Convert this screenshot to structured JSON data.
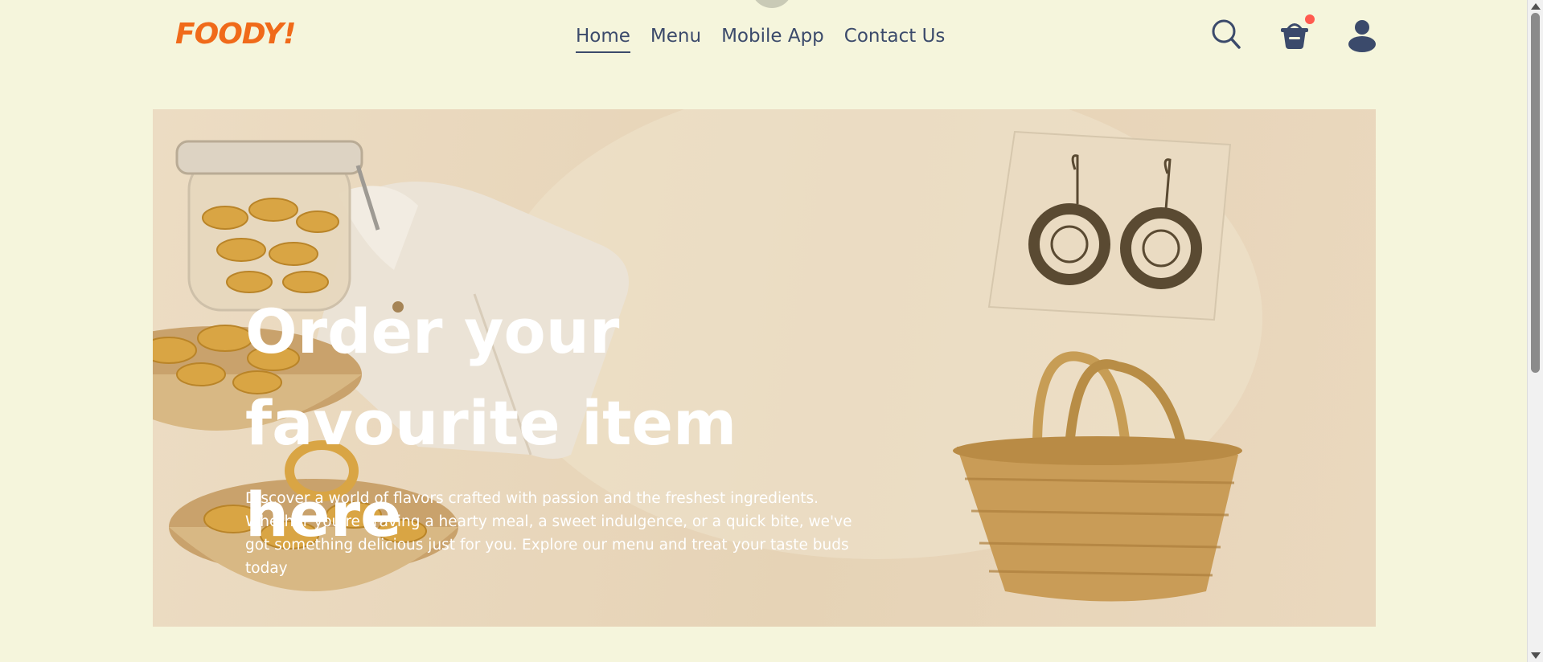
{
  "brand": {
    "logo_text": "FOODY!",
    "color": "#f06a1a"
  },
  "nav": {
    "items": [
      {
        "label": "Home",
        "active": true
      },
      {
        "label": "Menu",
        "active": false
      },
      {
        "label": "Mobile App",
        "active": false
      },
      {
        "label": "Contact Us",
        "active": false
      }
    ]
  },
  "header_icons": [
    "search-icon",
    "basket-icon",
    "user-icon"
  ],
  "cart": {
    "has_notification": true,
    "badge_color": "#ff5a4f"
  },
  "hero": {
    "title": "Order your favourite item here",
    "description": "Discover a world of flavors crafted with passion and the freshest ingredients. Whether you're craving a hearty meal, a sweet indulgence, or a quick bite, we've got something delicious just for you. Explore our menu and treat your taste buds today"
  },
  "colors": {
    "page_bg": "#f5f5dc",
    "nav_text": "#3b4a6b",
    "hero_text": "#ffffff"
  }
}
